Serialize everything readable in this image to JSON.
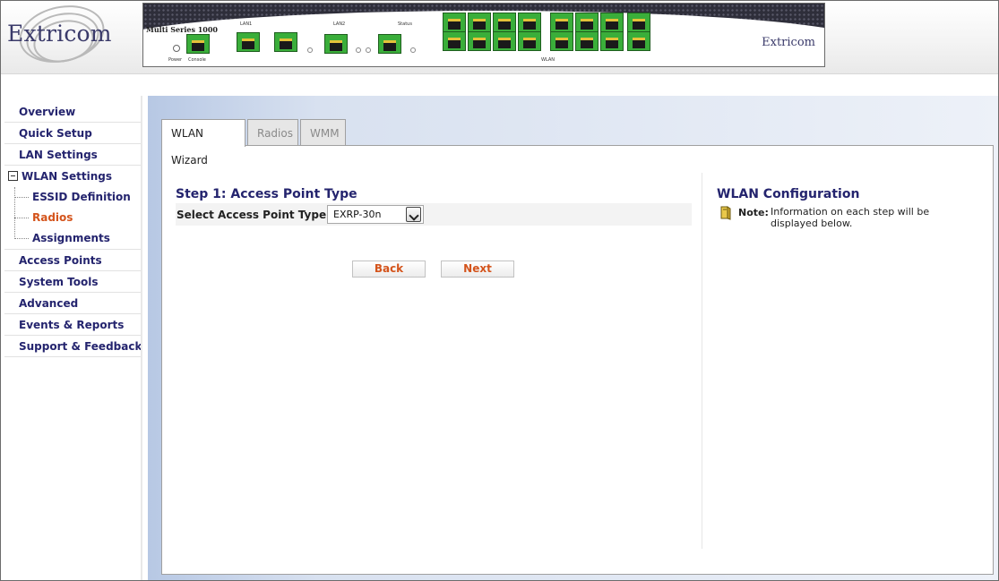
{
  "header": {
    "logo_text": "Extricom",
    "device": {
      "model": "Multi Series 1000",
      "labels": {
        "power": "Power",
        "console": "Console",
        "lan1": "LAN1",
        "lan2": "LAN2",
        "status": "Status",
        "wlan": "WLAN"
      },
      "logo_text": "Extricom"
    }
  },
  "sidebar": {
    "items": [
      {
        "label": "Overview"
      },
      {
        "label": "Quick Setup"
      },
      {
        "label": "LAN Settings"
      },
      {
        "label": "WLAN Settings"
      },
      {
        "label": "ESSID Definition"
      },
      {
        "label": "Radios"
      },
      {
        "label": "Assignments"
      },
      {
        "label": "Access Points"
      },
      {
        "label": "System Tools"
      },
      {
        "label": "Advanced"
      },
      {
        "label": "Events & Reports"
      },
      {
        "label": "Support & Feedback"
      }
    ]
  },
  "tabs": [
    {
      "label": "WLAN Wizard"
    },
    {
      "label": "Radios"
    },
    {
      "label": "WMM"
    }
  ],
  "wizard": {
    "step_title": "Step 1: Access Point Type",
    "field_label": "Select Access Point Type:",
    "selected_type": "EXRP-30n",
    "back_label": "Back",
    "next_label": "Next"
  },
  "info": {
    "title": "WLAN Configuration",
    "note_label": "Note:",
    "note_text": "Information on each step will be displayed below."
  },
  "colors": {
    "nav_text": "#24246e",
    "active_orange": "#d4541c",
    "device_purple": "#5a2e9a"
  }
}
